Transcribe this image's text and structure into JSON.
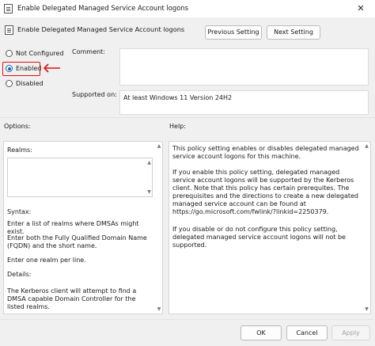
{
  "window": {
    "title": "Enable Delegated Managed Service Account logons",
    "close_glyph": "✕"
  },
  "header": {
    "title": "Enable Delegated Managed Service Account logons",
    "prev_label": "Previous Setting",
    "next_label": "Next Setting"
  },
  "state": {
    "options": [
      {
        "label": "Not Configured",
        "selected": false
      },
      {
        "label": "Enabled",
        "selected": true
      },
      {
        "label": "Disabled",
        "selected": false
      }
    ]
  },
  "comment": {
    "label": "Comment:",
    "value": ""
  },
  "supported": {
    "label": "Supported on:",
    "value": "At least Windows 11 Version 24H2"
  },
  "options_panel": {
    "label": "Options:",
    "realms_label": "Realms:",
    "lines": [
      "Syntax:",
      "Enter a list of realms where DMSAs might exist.",
      "Enter both the Fully Qualified Domain Name (FQDN) and the short name.",
      "Enter one realm per line.",
      "Details:",
      "The Kerberos client will attempt to find a DMSA capable Domain Controller for the listed realms."
    ]
  },
  "help_panel": {
    "label": "Help:",
    "paragraphs": [
      "This policy setting enables or disables delegated managed service account logons for this machine.",
      "If you enable this policy setting, delegated managed service account logons will be supported by the Kerberos client. Note that this policy has certain prerequites. The prerequisites and the directions to create a new delegated managed service account can be found at https://go.microsoft.com/fwlink/?linkid=2250379.",
      "If you disable or do not configure this policy setting, delegated managed service account logons will not be supported."
    ]
  },
  "footer": {
    "ok_label": "OK",
    "cancel_label": "Cancel",
    "apply_label": "Apply"
  },
  "colors": {
    "highlight": "#dd1111",
    "radio_selected": "#1a5fb4"
  }
}
